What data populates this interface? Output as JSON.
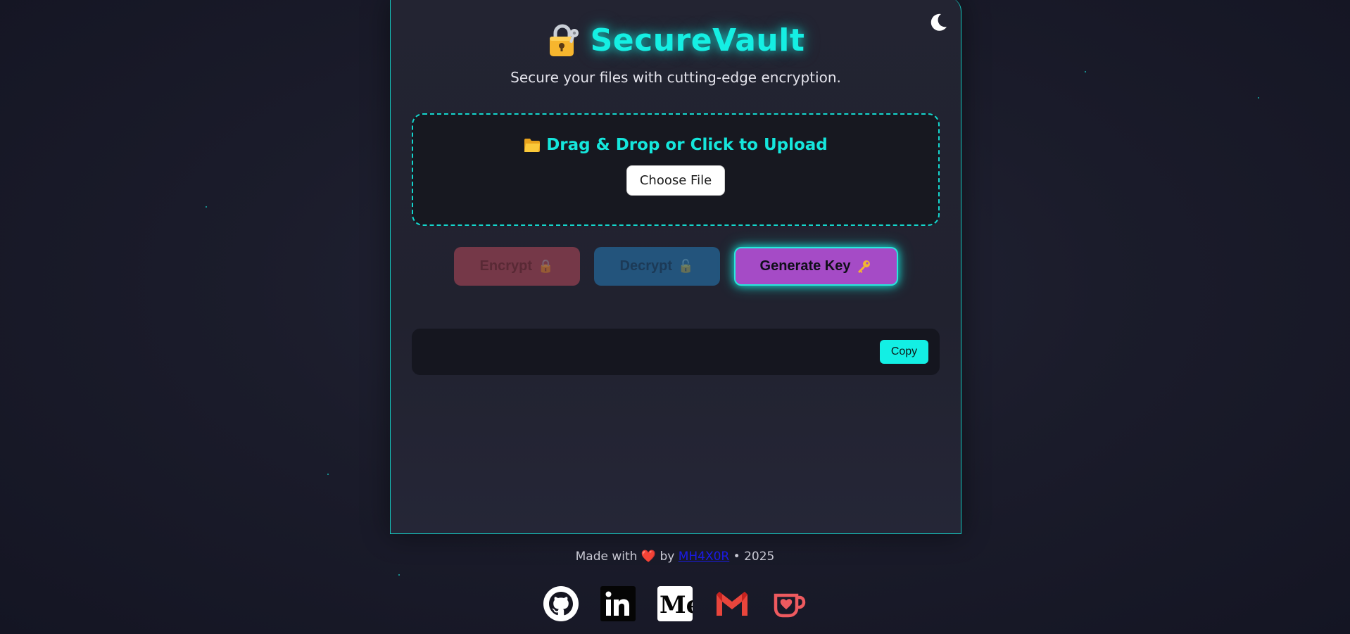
{
  "app": {
    "title": "SecureVault",
    "subtitle": "Secure your files with cutting-edge encryption.",
    "theme_icon": "moon-icon",
    "accent_color": "#15efe3"
  },
  "upload": {
    "label": "Drag & Drop or Click to Upload",
    "icon": "folder-icon",
    "choose_button": "Choose File"
  },
  "actions": {
    "encrypt_label": "Encrypt",
    "encrypt_icon": "lock-icon",
    "decrypt_label": "Decrypt",
    "decrypt_icon": "unlock-icon",
    "generate_label": "Generate Key",
    "generate_icon": "key-icon"
  },
  "key_output": {
    "value": "",
    "copy_label": "Copy"
  },
  "footer": {
    "made_with": "Made with",
    "by": "by",
    "author": "MH4X0R",
    "year": "• 2025",
    "heart_icon": "heart-icon"
  },
  "socials": [
    {
      "name": "github-icon"
    },
    {
      "name": "linkedin-icon"
    },
    {
      "name": "medium-icon"
    },
    {
      "name": "gmail-icon"
    },
    {
      "name": "kofi-icon"
    }
  ]
}
